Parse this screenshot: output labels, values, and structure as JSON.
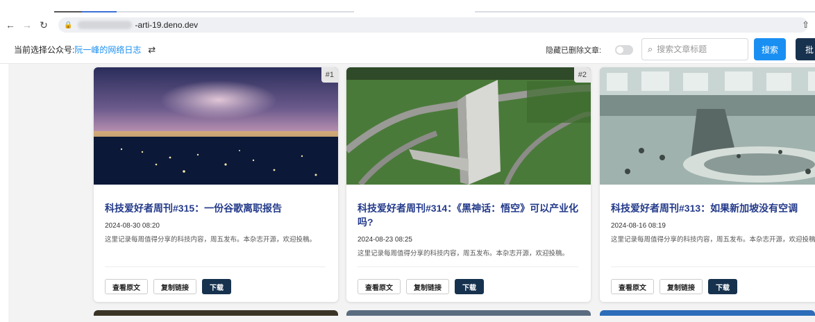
{
  "browser": {
    "url_suffix": "-arti-19.deno.dev"
  },
  "header": {
    "current_label": "当前选择公众号:",
    "account_name": "阮一峰的网络日志",
    "swap_glyph": "⇄",
    "hide_deleted_label": "隐藏已删除文章:",
    "search_placeholder": "搜索文章标题",
    "search_button": "搜索",
    "extra_button": "批"
  },
  "articles": [
    {
      "badge": "#1",
      "title": "科技爱好者周刊#315：一份谷歌离职报告",
      "date": "2024-08-30 08:20",
      "desc": "这里记录每周值得分享的科技内容，周五发布。本杂志开源，欢迎投稿。"
    },
    {
      "badge": "#2",
      "title": "科技爱好者周刊#314：《黑神话：悟空》可以产业化吗?",
      "date": "2024-08-23 08:25",
      "desc": "这里记录每周值得分享的科技内容，周五发布。本杂志开源，欢迎投稿。"
    },
    {
      "badge": "",
      "title": "科技爱好者周刊#313：如果新加坡没有空调",
      "date": "2024-08-16 08:19",
      "desc": "这里记录每周值得分享的科技内容，周五发布。本杂志开源，欢迎投稿。"
    }
  ],
  "card_buttons": {
    "view": "查看原文",
    "copy": "复制链接",
    "download": "下载"
  },
  "colors": {
    "accent": "#1a8ff2",
    "dark_button": "#17324e",
    "title": "#233a8a"
  }
}
